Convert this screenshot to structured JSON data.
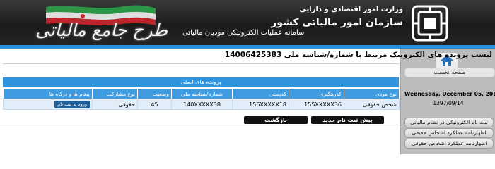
{
  "header": {
    "ministry": "وزارت امور اقتصادی و دارایی",
    "organization": "سازمان امور مالیاتی کشور",
    "subtitle": "سامانه عملیات الکترونیکی مودیان مالیاتی",
    "slogan": "طرح جامع مالیاتی",
    "logo_icon": "tax-organization-logo"
  },
  "sidebar": {
    "home_label": "صفحه نخست",
    "date_en": "Wednesday, December 05, 2018",
    "date_fa": "1397/09/14",
    "items": [
      {
        "label": "ثبت نام الکترونیکی در نظام مالیاتی"
      },
      {
        "label": "اظهارنامه عملکرد اشخاص حقیقی"
      },
      {
        "label": "اظهارنامه عملکرد اشخاص حقوقی"
      }
    ]
  },
  "main": {
    "title": "لیست پرونده های الکترونیک مرتبط با شماره/شناسه ملی 14006425383",
    "panel_title": "پرونده های اصلی",
    "columns": [
      "نوع مودی",
      "کدرهگیری",
      "کدپستی",
      "شماره/شناسه ملی",
      "وضعیت",
      "نوع مشارکت",
      "پیغام ها و درگاه ها"
    ],
    "rows": [
      {
        "taxpayer_type": "شخص حقوقی",
        "tracking_code": "155XXXXX36",
        "postal_code": "156XXXXX18",
        "national_id": "140XXXXX38",
        "status": "45",
        "participation_type": "حقوقی",
        "action": "ورود به ثبت نام"
      }
    ],
    "buttons": {
      "new_registration": "پیش ثبت نام جدید",
      "back": "بازگشت"
    }
  },
  "colors": {
    "header_bg": "#1b1b1b",
    "accent_blue": "#2f94dc",
    "sidebar_bg": "#bcbcbc",
    "row_bg": "#e1eef9"
  }
}
